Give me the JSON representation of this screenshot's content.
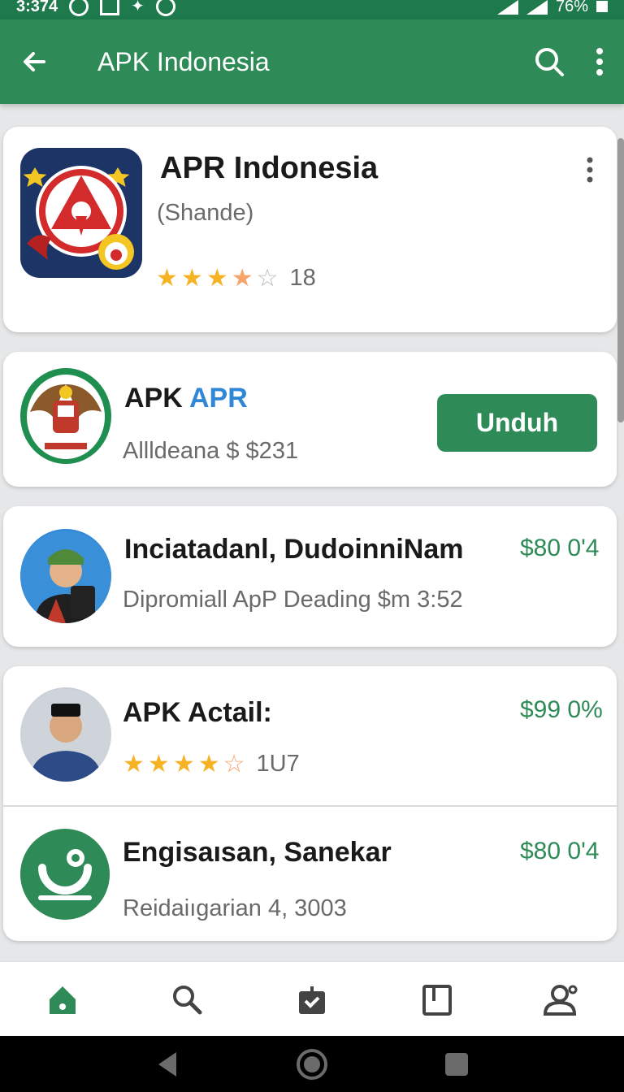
{
  "status_bar": {
    "time": "3:374",
    "battery": "76%"
  },
  "app_bar": {
    "title": "APK Indonesia",
    "icons": [
      "back-arrow-icon",
      "search-icon",
      "more-vert-icon"
    ]
  },
  "featured": {
    "title": "APR Indonesia",
    "subtitle": "(Shande)",
    "rating_count": "18",
    "stars": [
      "full",
      "full",
      "half",
      "half",
      "empty"
    ]
  },
  "install_card": {
    "title_part1": "APK",
    "title_part2": "APR",
    "subtitle": "Allldeana $ $231",
    "button_label": "Unduh"
  },
  "list": [
    {
      "title": "Inciatadanl, DudoinniNam",
      "subtitle": "Dipromiall ApP Deading $m 3:52",
      "price": "$80 0'4"
    },
    {
      "title": "APK Actail:",
      "rating_count": "1U7",
      "price": "$99 0%",
      "stars": [
        "full",
        "full",
        "full",
        "full",
        "half"
      ]
    },
    {
      "title": "Engisaısan, Sanekar",
      "subtitle": "Reidaiıgarian 4, 3003",
      "price": "$80 0'4"
    }
  ],
  "bottom_nav": [
    "home-icon",
    "search-icon",
    "downloads-icon",
    "library-icon",
    "account-icon"
  ],
  "colors": {
    "primary": "#2e8b57",
    "status_bar": "#1e7a4c",
    "star": "#f5b324"
  }
}
